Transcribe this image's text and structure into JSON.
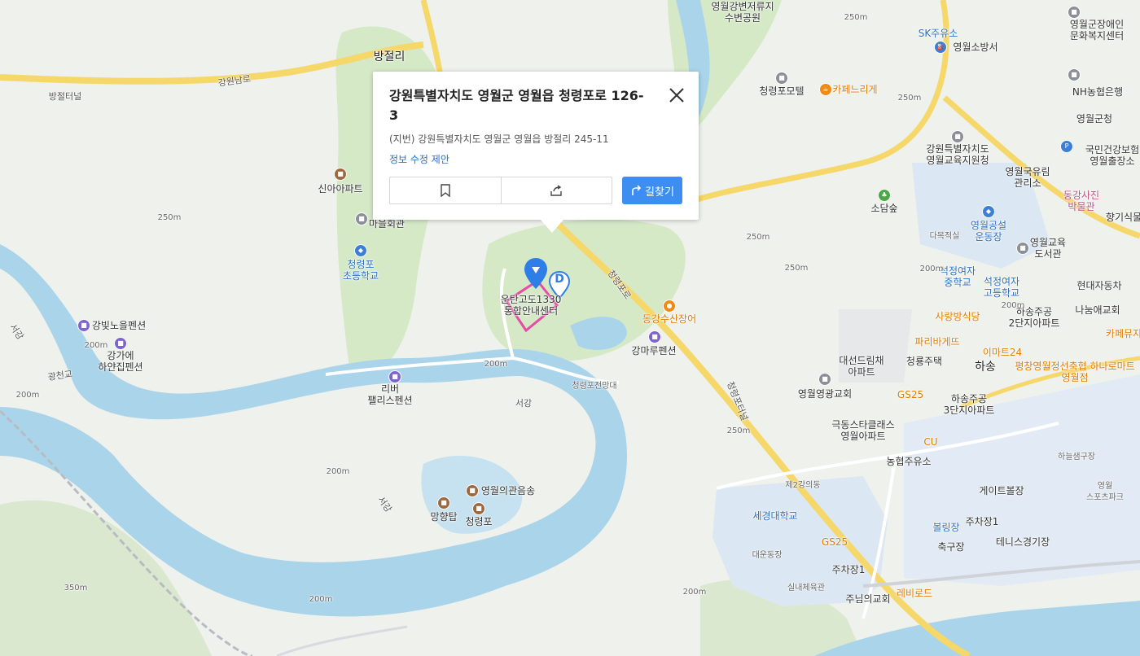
{
  "popup": {
    "title": "강원특별자치도 영월군 영월읍 청령포로 126-3",
    "jibun": "(지번) 강원특별자치도 영월군 영월읍 방절리 245-11",
    "edit_link": "정보 수정 제안",
    "route_label": "길찾기",
    "close_icon": "close-icon",
    "bookmark_icon": "bookmark-icon",
    "share_icon": "share-icon",
    "route_icon": "route-arrow-icon",
    "accent_color": "#3d8ef0"
  },
  "marker": {
    "place_name": "운탄고도1330\n통합안내센터",
    "d_label": "D",
    "marker_color": "#2f7ee8",
    "boundary_color": "#e84aa6"
  },
  "map": {
    "colors": {
      "land": "#eef1ec",
      "forest": "#d5e9c7",
      "water": "#a9d4ea",
      "road_major": "#f5d76a",
      "road_minor": "#ffffff",
      "urban": "#dbe7f3"
    },
    "labels": {
      "bangjeolli": "방절리",
      "gangwonnamro": "강원남로",
      "bangjeol_tunnel": "방절터널",
      "yeongwolgangbyeon": "영월강변저류지\n수변공원",
      "cheongnyeongpo_motel": "청령포모텔",
      "cafe_nrige": "카페느리게",
      "sk_gas": "SK주유소",
      "fire_station": "영월소방서",
      "disabled_welfare": "영월군장애인\n문화복지센터",
      "nh_bank": "NH농협은행",
      "county_office": "영월군청",
      "health_insurance": "국민건강보험\n영월출장소",
      "edu_support": "강원특별자치도\n영월교육지원청",
      "sodamsup": "소담숲",
      "forest_office": "영월국유림\n관리소",
      "photo_museum": "동강사진\n박물관",
      "hyanggi": "향기식물",
      "stadium": "영월공설\n운동장",
      "dajeok": "다목적실",
      "edu_library": "영월교육\n도서관",
      "seokjeong_mid": "석정여자\n중학교",
      "seokjeong_high": "석정여자\n고등학교",
      "hyundai": "현대자동차",
      "sarangbang": "사랑방식당",
      "hasong_apt2": "하송주공\n2단지아파트",
      "nanum_church": "나눔애교회",
      "cafe_my": "카페뮤지",
      "paris": "파리바게뜨",
      "emart24": "이마트24",
      "pyeongchang_coop": "평창영월정선축협 하나로마트\n영월점",
      "hasong": "하송",
      "daesun_apt": "대선드림채\n아파트",
      "cheongnyeong_house": "청룡주택",
      "gs25_a": "GS25",
      "hasong_apt3": "하송주공\n3단지아파트",
      "yeongwol_church": "영월영광교회",
      "kukdong_apt": "극동스타클래스\n영월아파트",
      "cu": "CU",
      "nh_gas": "농협주유소",
      "haneulsaem": "하늘샘구장",
      "sports_park": "영월\n스포츠파크",
      "gate_ball": "게이트볼장",
      "parking1": "주차장1",
      "bowling": "볼링장",
      "football": "축구장",
      "tennis": "테니스경기장",
      "sekyung_univ": "세경대학교",
      "campus2": "제2강의동",
      "gs25_b": "GS25",
      "daeun": "대운동장",
      "parking1_b": "주차장1",
      "indoor_gym": "실내체육관",
      "lord_church": "주님의교회",
      "levi_road": "레비로드",
      "sinan_apt": "신아아파트",
      "village_hall": "마을회관",
      "cheongnyeongpo_elem": "청령포\n초등학교",
      "gangbit": "강빛노을펜션",
      "ganggae": "강가에\n하얀집펜션",
      "river_west": "서강",
      "bridge_gwangcheon": "광천교",
      "river_pension": "리버\n팰리스펜션",
      "observatory": "청령포전망대",
      "donggang_eel": "동강수산장어",
      "gangmaru": "강마루펜션",
      "cheongnyeongpo_ro": "청령포로",
      "cheongnyeongpo_tunnel": "청령포터널",
      "seogang_river": "서강",
      "yeongwol_uigwan": "영월의관음송",
      "manghyangtap": "망향탑",
      "cheongnyeongpo": "청령포",
      "seogang_river2": "서강",
      "alt_250_a": "250m",
      "alt_250_b": "250m",
      "alt_250_c": "250m",
      "alt_250_d": "250m",
      "alt_250_e": "250m",
      "alt_200_a": "200m",
      "alt_200_b": "200m",
      "alt_200_c": "200m",
      "alt_200_d": "200m",
      "alt_200_e": "200m",
      "alt_200_f": "200m",
      "alt_200_g": "200m",
      "alt_200_h": "200m",
      "alt_350": "350m"
    }
  }
}
